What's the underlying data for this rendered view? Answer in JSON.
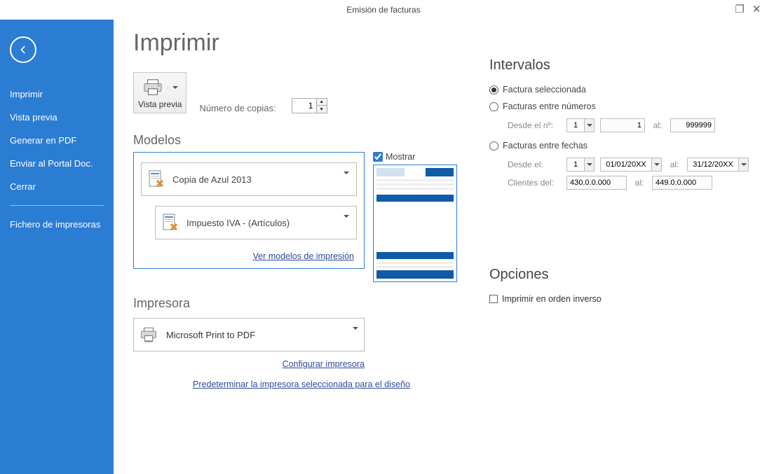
{
  "window": {
    "title": "Emisión de facturas"
  },
  "sidebar": {
    "items": [
      {
        "label": "Imprimir"
      },
      {
        "label": "Vista previa"
      },
      {
        "label": "Generar en PDF"
      },
      {
        "label": "Enviar al Portal Doc."
      },
      {
        "label": "Cerrar"
      }
    ],
    "footer": {
      "label": "Fichero de impresoras"
    }
  },
  "page": {
    "title": "Imprimir",
    "preview_button": "Vista previa",
    "copies_label": "Número de copias:",
    "copies_value": "1"
  },
  "modelos": {
    "heading": "Modelos",
    "model1": "Copia de Azul 2013",
    "model2": "Impuesto IVA - (Artículos)",
    "link": "Ver modelos de impresión",
    "mostrar_label": "Mostrar",
    "mostrar_checked": true
  },
  "impresora": {
    "heading": "Impresora",
    "printer": "Microsoft Print to PDF",
    "config_link": "Configurar impresora",
    "default_link": "Predeterminar la impresora seleccionada para el diseño"
  },
  "intervals": {
    "heading": "Intervalos",
    "r1": "Factura seleccionada",
    "r2": "Facturas entre números",
    "r3": "Facturas entre fechas",
    "desde_n": "Desde el nº:",
    "al": "al:",
    "desde_el": "Desde el:",
    "clientes": "Clientes del:",
    "n_from_combo": "1",
    "n_from_val": "1",
    "n_to_val": "999999",
    "d_combo": "1",
    "d_from": "01/01/20XX",
    "d_to": "31/12/20XX",
    "cli_from": "430.0.0.000",
    "cli_to": "449.0.0.000"
  },
  "opciones": {
    "heading": "Opciones",
    "reverse": "Imprimir en orden inverso"
  }
}
